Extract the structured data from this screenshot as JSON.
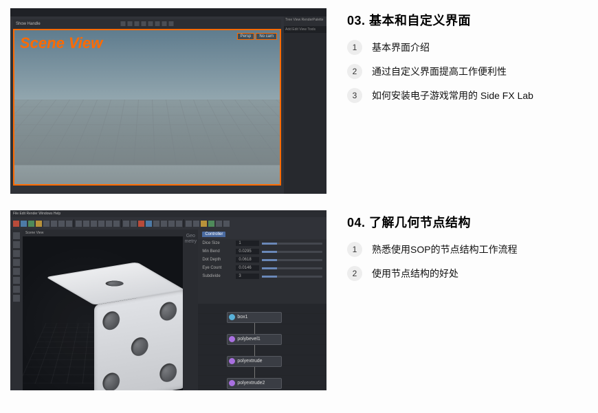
{
  "sections": [
    {
      "heading": "03. 基本和自定义界面",
      "items": [
        {
          "num": "1",
          "label": "基本界面介绍"
        },
        {
          "num": "2",
          "label": "通过自定义界面提高工作便利性"
        },
        {
          "num": "3",
          "label": "如何安装电子游戏常用的 Side FX Lab"
        }
      ],
      "thumb": {
        "scene_label": "Scene View",
        "share_label": "Show Handle",
        "btn1": "Persp",
        "btn2": "No cam",
        "side_tabs": "Tree View  RenderPalette",
        "side_strip": "Add  Edit  View  Tools"
      }
    },
    {
      "heading": "04. 了解几何节点结构",
      "items": [
        {
          "num": "1",
          "label": "熟悉使用SOP的节点结构工作流程"
        },
        {
          "num": "2",
          "label": "使用节点结构的好处"
        }
      ],
      "thumb": {
        "menubar": "File  Edit  Render  Windows  Help",
        "geo_label": "Geo\nmetry",
        "vp_tabs": "Scene View",
        "param_tab1": "Controller",
        "params": [
          {
            "label": "Dice Size",
            "value": "1"
          },
          {
            "label": "Min Bend",
            "value": "0.0295"
          },
          {
            "label": "Dot Depth",
            "value": "0.0618"
          },
          {
            "label": "Eye Count",
            "value": "0.0146"
          },
          {
            "label": "Subdivide",
            "value": "3"
          }
        ],
        "nodes": {
          "n1": "box1",
          "n2": "polybevel1",
          "n3": "polyextrude",
          "n4": "polyextrude2"
        }
      }
    }
  ]
}
